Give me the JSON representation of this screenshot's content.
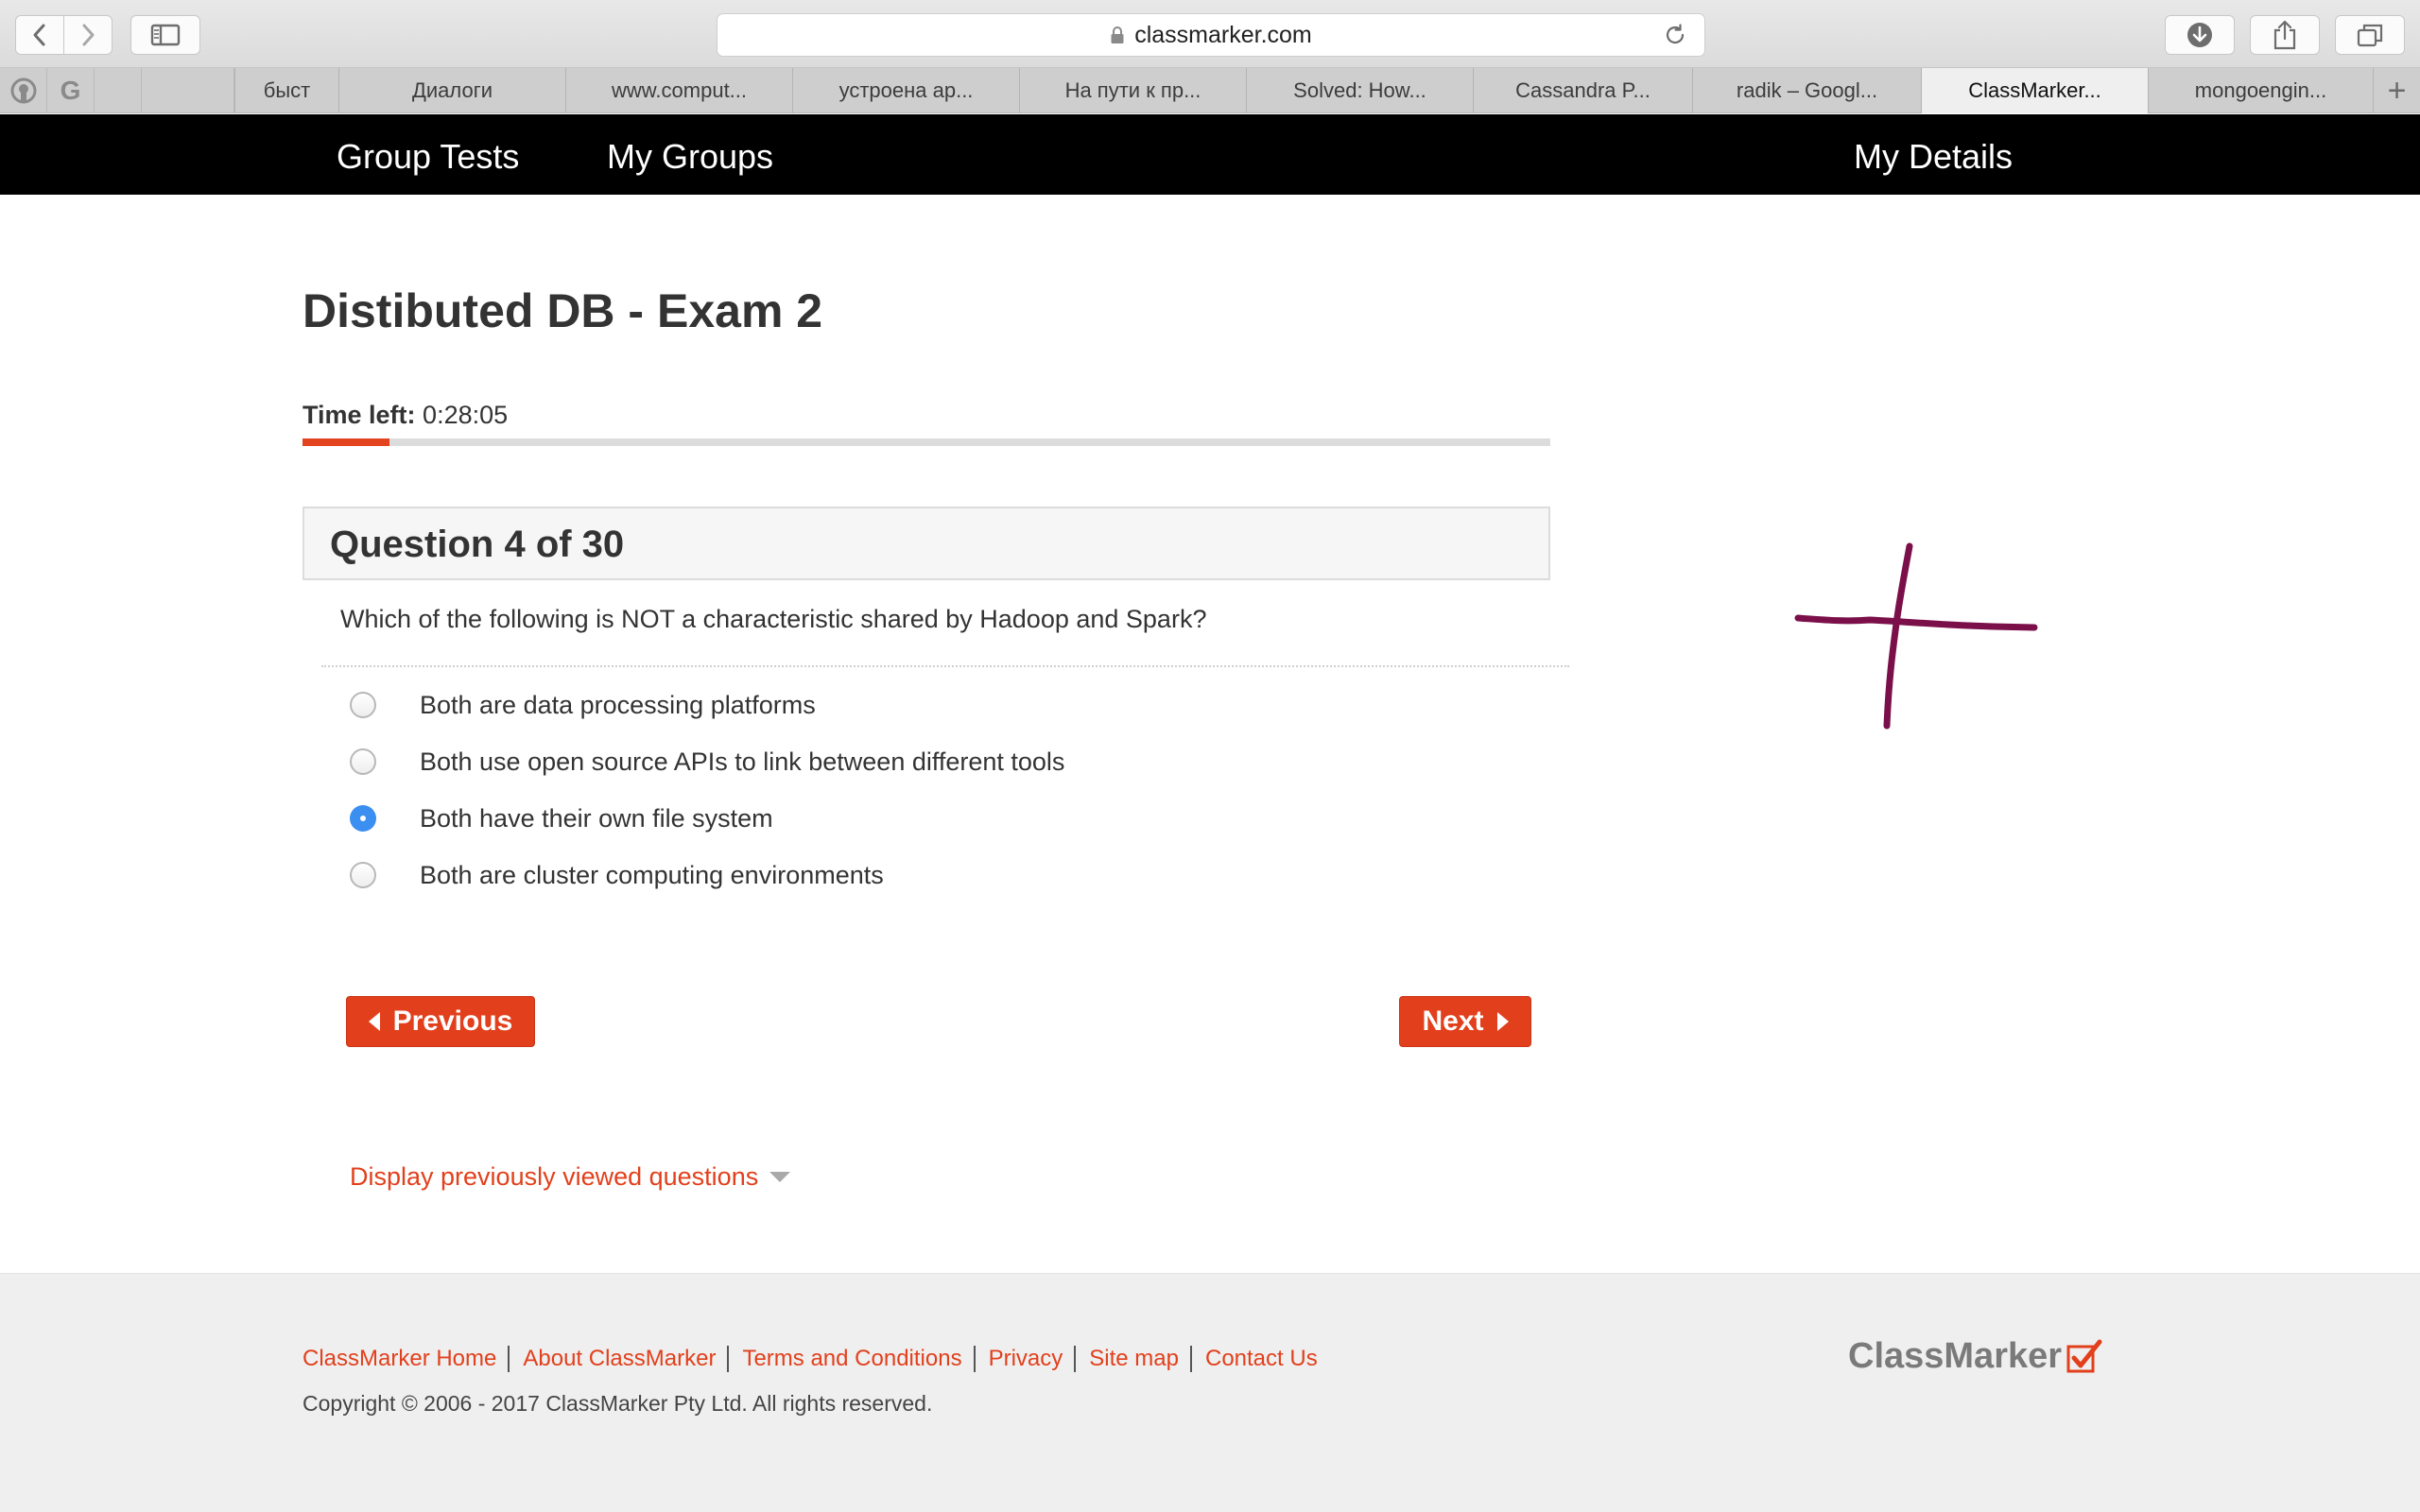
{
  "browser": {
    "url": "classmarker.com",
    "pinned_tabs": [
      {
        "icon": "github-icon"
      },
      {
        "icon": "google-icon",
        "glyph": "G"
      },
      {
        "icon": "blank-icon"
      }
    ],
    "tabs": [
      {
        "label": "быст",
        "active": false
      },
      {
        "label": "Диалоги",
        "active": false
      },
      {
        "label": "www.comput...",
        "active": false
      },
      {
        "label": "устроена ар...",
        "active": false
      },
      {
        "label": "На пути к пр...",
        "active": false
      },
      {
        "label": "Solved: How...",
        "active": false
      },
      {
        "label": "Cassandra P...",
        "active": false
      },
      {
        "label": "radik – Googl...",
        "active": false
      },
      {
        "label": "ClassMarker...",
        "active": true
      },
      {
        "label": "mongoengin...",
        "active": false
      }
    ],
    "new_tab_glyph": "+"
  },
  "site_nav": {
    "group_tests": "Group Tests",
    "my_groups": "My Groups",
    "my_details": "My Details"
  },
  "exam": {
    "title": "Distibuted DB - Exam 2",
    "time_label": "Time left:",
    "time_value": "0:28:05",
    "progress_fraction": 0.07,
    "question_header": "Question 4 of 30",
    "question_text": "Which of the following is NOT a characteristic shared by Hadoop and Spark?",
    "answers": [
      {
        "label": "Both are data processing platforms",
        "selected": false
      },
      {
        "label": "Both use open source APIs to link between different tools",
        "selected": false
      },
      {
        "label": "Both have their own file system",
        "selected": true
      },
      {
        "label": "Both are cluster computing environments",
        "selected": false
      }
    ],
    "previous_label": "Previous",
    "next_label": "Next",
    "display_previous_label": "Display previously viewed questions"
  },
  "footer": {
    "links": [
      "ClassMarker Home",
      "About ClassMarker",
      "Terms and Conditions",
      "Privacy",
      "Site map",
      "Contact Us"
    ],
    "copyright": "Copyright © 2006 - 2017 ClassMarker Pty Ltd. All rights reserved.",
    "logo_text": "ClassMarker"
  },
  "colors": {
    "accent": "#e2401c",
    "nav_background": "#000000",
    "radio_selected": "#3b8ff0",
    "annotation_stroke": "#7a0f4a"
  }
}
